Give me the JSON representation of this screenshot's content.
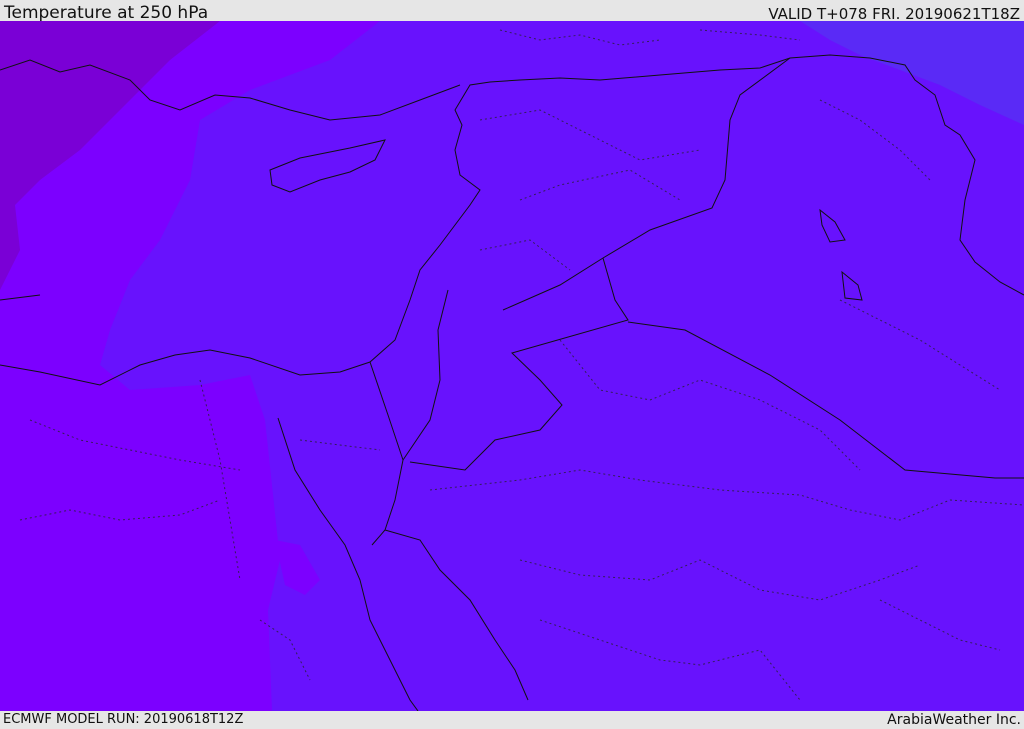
{
  "header": {
    "title": "Temperature at 250 hPa",
    "valid": "VALID T+078 FRI. 20190621T18Z"
  },
  "footer": {
    "model_run": "ECMWF MODEL RUN: 20190618T12Z",
    "credit": "ArabiaWeather Inc."
  },
  "map": {
    "colors": {
      "dark_violet": "#7a00d6",
      "violet": "#7c00ff",
      "blue_violet": "#6812fd",
      "blue": "#5a2af6",
      "border": "#111111"
    }
  }
}
